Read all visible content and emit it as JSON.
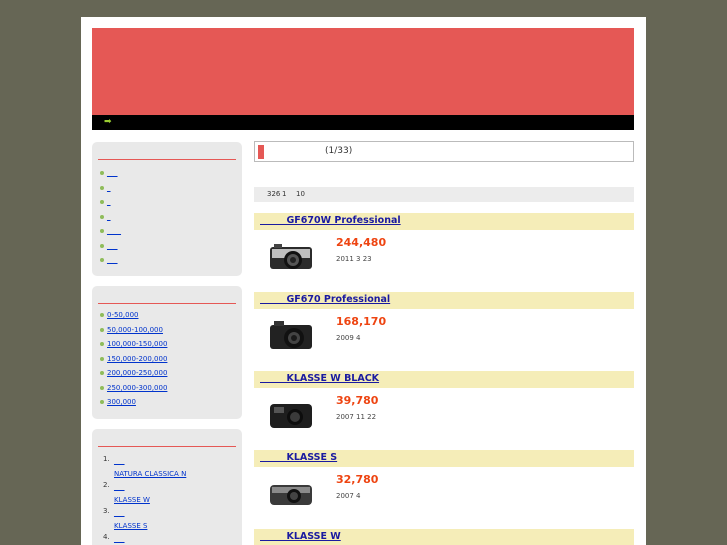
{
  "banner": {
    "color": "#e55855"
  },
  "topbar": {
    "arrow_icon": "arrow-right-icon"
  },
  "sidebar": {
    "box1": {
      "items": [
        "___",
        "_",
        "_",
        "_",
        "____",
        "___",
        "___"
      ]
    },
    "box2": {
      "items": [
        "0-50,000",
        "50,000-100,000",
        "100,000-150,000",
        "150,000-200,000",
        "200,000-250,000",
        "250,000-300,000",
        "300,000"
      ]
    },
    "ranking": {
      "items": [
        {
          "num": "1.",
          "line1": "___",
          "line2": "NATURA CLASSICA N"
        },
        {
          "num": "2.",
          "line1": "___",
          "line2": "KLASSE W"
        },
        {
          "num": "3.",
          "line1": "___",
          "line2": "KLASSE S"
        },
        {
          "num": "4.",
          "line1": "___",
          "line2": ""
        }
      ]
    }
  },
  "main": {
    "header": {
      "page_label": "(1/33)"
    },
    "pager": {
      "total": "326",
      "from": "1",
      "to": "10"
    },
    "products": [
      {
        "title": "        GF670W Professional",
        "price": "244,480",
        "date": "2011 3 23"
      },
      {
        "title": "        GF670 Professional",
        "price": "168,170",
        "date": "2009 4"
      },
      {
        "title": "        KLASSE W BLACK",
        "price": "39,780",
        "date": "2007 11 22"
      },
      {
        "title": "        KLASSE S",
        "price": "32,780",
        "date": "2007 4"
      },
      {
        "title": "        KLASSE W",
        "price": "",
        "date": ""
      }
    ]
  }
}
